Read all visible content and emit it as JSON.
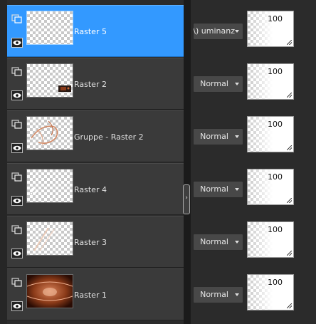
{
  "layers": [
    {
      "name": "Raster 5",
      "blend_mode": "uminanz (\\",
      "opacity": "100",
      "selected": true,
      "blend_clipped": true
    },
    {
      "name": "Raster 2",
      "blend_mode": "Normal",
      "opacity": "100",
      "selected": false
    },
    {
      "name": "Gruppe - Raster 2",
      "blend_mode": "Normal",
      "opacity": "100",
      "selected": false
    },
    {
      "name": "Raster 4",
      "blend_mode": "Normal",
      "opacity": "100",
      "selected": false
    },
    {
      "name": "Raster 3",
      "blend_mode": "Normal",
      "opacity": "100",
      "selected": false
    },
    {
      "name": "Raster 1",
      "blend_mode": "Normal",
      "opacity": "100",
      "selected": false
    }
  ],
  "icons": {
    "layer_type": "layer-stack-icon",
    "visibility": "eye-icon",
    "splitter_handle": "chevron-right-icon"
  },
  "colors": {
    "selected_row": "#3399ff",
    "row": "#3a3a3a",
    "panel": "#2b2b2b",
    "thumb_accent": "#8a3a18"
  }
}
